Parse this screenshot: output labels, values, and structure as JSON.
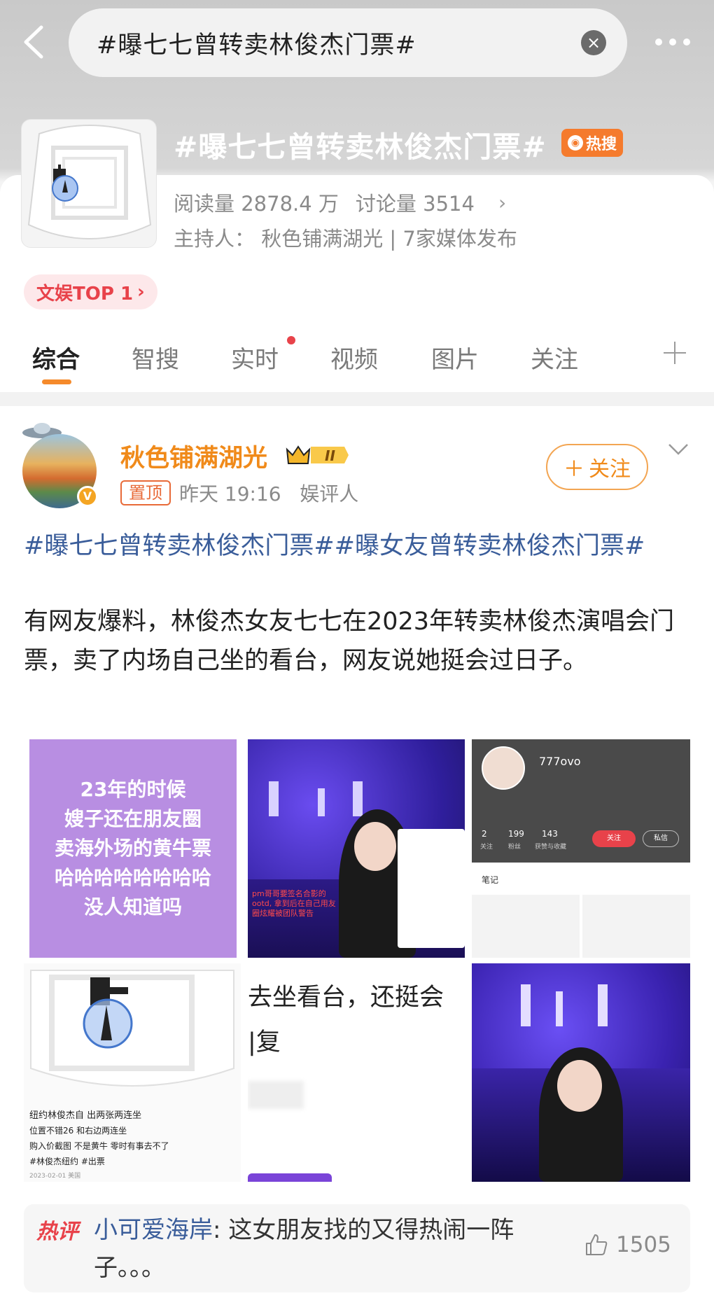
{
  "header": {
    "search_text": "#曝七七曾转卖林俊杰门票#",
    "clear_icon": "×"
  },
  "topic": {
    "title": "#曝七七曾转卖林俊杰门票#",
    "hot_badge": "热搜",
    "read_count": "阅读量 2878.4 万",
    "discuss_count": "讨论量 3514",
    "chevron": "›",
    "host": "主持人：  秋色铺满湖光 | 7家媒体发布",
    "rank_tag": "文娱TOP 1",
    "rank_chevron": "›"
  },
  "tabs": [
    "综合",
    "智搜",
    "实时",
    "视频",
    "图片",
    "关注"
  ],
  "post": {
    "username": "秋色铺满湖光",
    "vip_level": "II",
    "pin_label": "置顶",
    "time": "昨天 19:16",
    "role": "娱评人",
    "follow_label": "关注",
    "tags": "#曝七七曾转卖林俊杰门票##曝女友曾转卖林俊杰门票#",
    "body": "有网友爆料，林俊杰女友七七在2023年转卖林俊杰演唱会门票，卖了内场自己坐的看台，网友说她挺会过日子。",
    "image1_text": "23年的时候\n嫂子还在朋友圈\n卖海外场的黄牛票\n哈哈哈哈哈哈哈哈\n没人知道吗",
    "image2_caption": "pm哥哥要签名合影的ootd, 拿到后在自己用友圈炫耀被团队警告",
    "image3_profile_name": "777ovo",
    "image3_stats": [
      "2",
      "199",
      "143"
    ],
    "image3_stat_labels": [
      "关注",
      "粉丝",
      "获赞与收藏"
    ],
    "image3_follow": "关注",
    "image3_message": "私信",
    "image3_section": "笔记",
    "image4_caption_1": "纽约林俊杰自  出两张两连坐",
    "image4_caption_2": "位置不错26 和右边两连坐",
    "image4_caption_3": "购入价截图 不是黄牛 零时有事去不了",
    "image4_caption_4": "#林俊杰纽约 #出票",
    "image4_date": "2023-02-01 美国",
    "image5_text_1": "去坐看台，还挺会",
    "image5_text_2": "|复"
  },
  "hot_comment": {
    "label": "热评",
    "user": "小可爱海岸",
    "text": ": 这女朋友找的又得热闹一阵子。。。",
    "likes": "1505"
  },
  "colors": {
    "accent_orange": "#f08a1a",
    "link_blue": "#3a5d9a",
    "hot_red": "#e8424a"
  }
}
